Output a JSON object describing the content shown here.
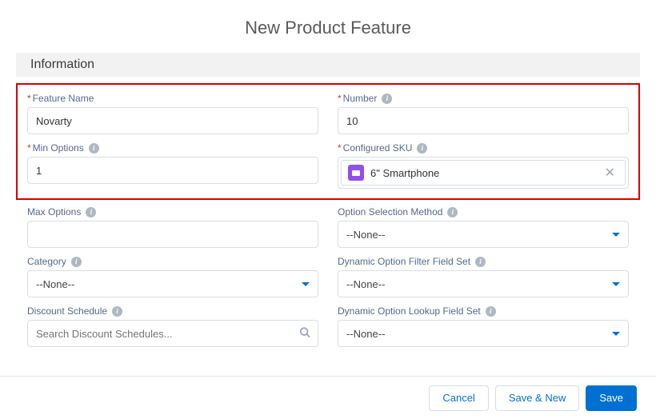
{
  "title": "New Product Feature",
  "section": "Information",
  "fields": {
    "featureName": {
      "label": "Feature Name",
      "value": "Novarty"
    },
    "number": {
      "label": "Number",
      "value": "10"
    },
    "minOptions": {
      "label": "Min Options",
      "value": "1"
    },
    "configuredSku": {
      "label": "Configured SKU",
      "value": "6\" Smartphone"
    },
    "maxOptions": {
      "label": "Max Options",
      "value": ""
    },
    "optionSelectionMethod": {
      "label": "Option Selection Method",
      "value": "--None--"
    },
    "category": {
      "label": "Category",
      "value": "--None--"
    },
    "dynamicOptionFilter": {
      "label": "Dynamic Option Filter Field Set",
      "value": "--None--"
    },
    "discountSchedule": {
      "label": "Discount Schedule",
      "placeholder": "Search Discount Schedules..."
    },
    "dynamicOptionLookup": {
      "label": "Dynamic Option Lookup Field Set",
      "value": "--None--"
    }
  },
  "buttons": {
    "cancel": "Cancel",
    "saveNew": "Save & New",
    "save": "Save"
  }
}
